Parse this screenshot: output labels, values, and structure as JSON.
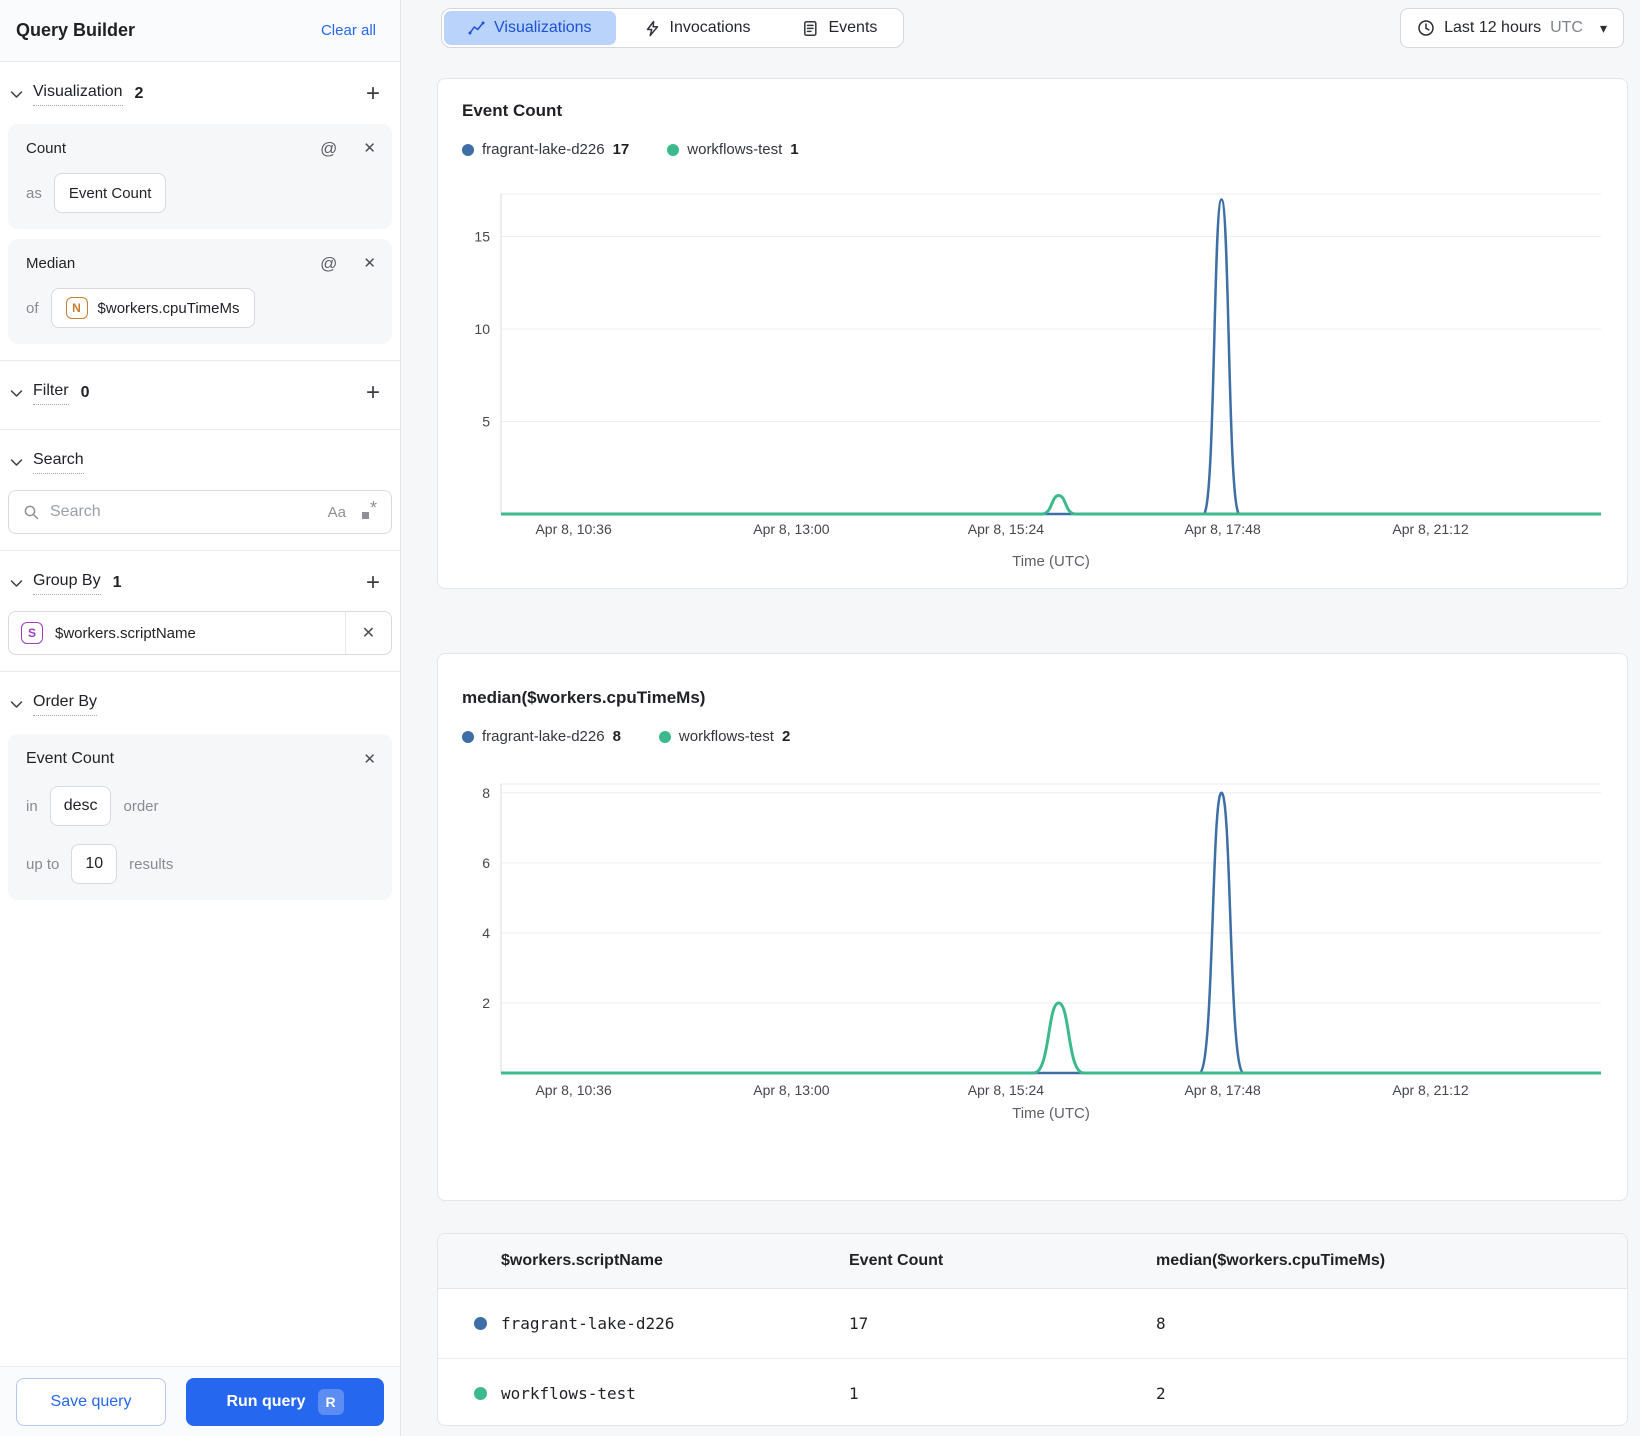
{
  "sidebar": {
    "title": "Query Builder",
    "clear_all": "Clear all",
    "sections": {
      "visualization": {
        "label": "Visualization",
        "count": "2"
      },
      "filter": {
        "label": "Filter",
        "count": "0"
      },
      "search": {
        "label": "Search"
      },
      "group_by": {
        "label": "Group By",
        "count": "1"
      },
      "order_by": {
        "label": "Order By"
      }
    },
    "visualizations": [
      {
        "fn": "Count",
        "prefix": "as",
        "value": "Event Count"
      },
      {
        "fn": "Median",
        "prefix": "of",
        "badge": "N",
        "value": "$workers.cpuTimeMs"
      }
    ],
    "search_placeholder": "Search",
    "group_by_chip": {
      "badge": "S",
      "value": "$workers.scriptName"
    },
    "order_by_card": {
      "field": "Event Count",
      "in_label": "in",
      "direction": "desc",
      "order_label": "order",
      "up_to_label": "up to",
      "limit": "10",
      "results_label": "results"
    },
    "save_button": "Save query",
    "run_button": "Run query",
    "run_shortcut": "R"
  },
  "topbar": {
    "tabs": [
      {
        "label": "Visualizations",
        "selected": true
      },
      {
        "label": "Invocations",
        "selected": false
      },
      {
        "label": "Events",
        "selected": false
      }
    ],
    "time_range": {
      "label": "Last 12 hours",
      "timezone": "UTC"
    }
  },
  "chart_data": [
    {
      "type": "line",
      "title": "Event Count",
      "xlabel": "Time (UTC)",
      "ylim": [
        0,
        17.3
      ],
      "y_ticks": [
        5,
        10,
        15
      ],
      "x_ticks": [
        {
          "label": "Apr 8, 10:36",
          "frac": 0.066
        },
        {
          "label": "Apr 8, 13:00",
          "frac": 0.264
        },
        {
          "label": "Apr 8, 15:24",
          "frac": 0.459
        },
        {
          "label": "Apr 8, 17:48",
          "frac": 0.656
        },
        {
          "label": "Apr 8, 21:12",
          "frac": 0.845
        }
      ],
      "legend": [
        {
          "name": "fragrant-lake-d226",
          "value": "17",
          "color": "#3d6fa6"
        },
        {
          "name": "workflows-test",
          "value": "1",
          "color": "#3cba8b"
        }
      ],
      "series": [
        {
          "name": "fragrant-lake-d226",
          "color": "#3d6fa6",
          "stroke_width": 2.5,
          "baseline": 0,
          "spikes": [
            {
              "x_frac": 0.655,
              "peak": 17,
              "half_width_frac": 0.0164,
              "time_approx": "Apr 8, 17:48"
            }
          ]
        },
        {
          "name": "workflows-test",
          "color": "#3cba8b",
          "stroke_width": 3,
          "baseline": 0,
          "spikes": [
            {
              "x_frac": 0.507,
              "peak": 1,
              "half_width_frac": 0.0155,
              "time_approx": "Apr 8, 15:40"
            }
          ]
        }
      ]
    },
    {
      "type": "line",
      "title": "median($workers.cpuTimeMs)",
      "xlabel": "Time (UTC)",
      "ylim": [
        0,
        8.25
      ],
      "y_ticks": [
        2,
        4,
        6,
        8
      ],
      "x_ticks": [
        {
          "label": "Apr 8, 10:36",
          "frac": 0.066
        },
        {
          "label": "Apr 8, 13:00",
          "frac": 0.264
        },
        {
          "label": "Apr 8, 15:24",
          "frac": 0.459
        },
        {
          "label": "Apr 8, 17:48",
          "frac": 0.656
        },
        {
          "label": "Apr 8, 21:12",
          "frac": 0.845
        }
      ],
      "legend": [
        {
          "name": "fragrant-lake-d226",
          "value": "8",
          "color": "#3d6fa6"
        },
        {
          "name": "workflows-test",
          "value": "2",
          "color": "#3cba8b"
        }
      ],
      "series": [
        {
          "name": "fragrant-lake-d226",
          "color": "#3d6fa6",
          "stroke_width": 2.5,
          "baseline": 0,
          "spikes": [
            {
              "x_frac": 0.655,
              "peak": 8,
              "half_width_frac": 0.02,
              "time_approx": "Apr 8, 17:48"
            }
          ]
        },
        {
          "name": "workflows-test",
          "color": "#3cba8b",
          "stroke_width": 3,
          "baseline": 0,
          "spikes": [
            {
              "x_frac": 0.507,
              "peak": 2,
              "half_width_frac": 0.0227,
              "time_approx": "Apr 8, 15:40"
            }
          ]
        }
      ]
    }
  ],
  "table": {
    "columns": [
      "$workers.scriptName",
      "Event Count",
      "median($workers.cpuTimeMs)"
    ],
    "rows": [
      {
        "name": "fragrant-lake-d226",
        "color": "#3d6fa6",
        "event_count": "17",
        "median": "8"
      },
      {
        "name": "workflows-test",
        "color": "#3cba8b",
        "event_count": "1",
        "median": "2"
      }
    ]
  },
  "colors": {
    "accent_blue": "#2667ef",
    "selected_tab_bg": "#b9d3fb",
    "series_blue": "#3d6fa6",
    "series_green": "#3cba8b",
    "badge_orange": "#c87f2e",
    "badge_purple": "#9c3dc2"
  }
}
